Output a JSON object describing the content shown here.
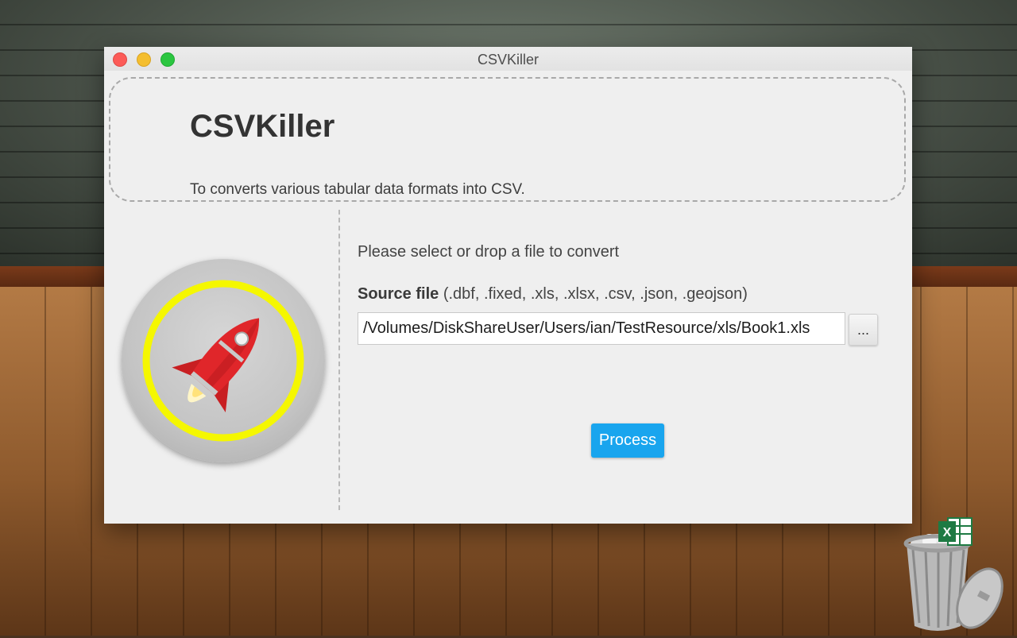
{
  "window": {
    "title": "CSVKiller"
  },
  "header": {
    "app_name": "CSVKiller",
    "description": "To converts various tabular data formats into CSV."
  },
  "main": {
    "prompt": "Please select or drop a file to convert",
    "source_label": "Source file",
    "source_formats": " (.dbf, .fixed, .xls, .xlsx, .csv, .json, .geojson)",
    "source_path": "/Volumes/DiskShareUser/Users/ian/TestResource/xls/Book1.xls",
    "browse_label": "...",
    "process_label": "Process"
  },
  "icons": {
    "logo": "rocket-icon",
    "trash": "trash-icon",
    "excel": "excel-icon"
  },
  "colors": {
    "accent": "#19a5ee",
    "close": "#fc5b57",
    "minimize": "#f4be2f",
    "maximize": "#2bc640",
    "logo_ring": "#f5f700",
    "rocket": "#e0262a"
  }
}
